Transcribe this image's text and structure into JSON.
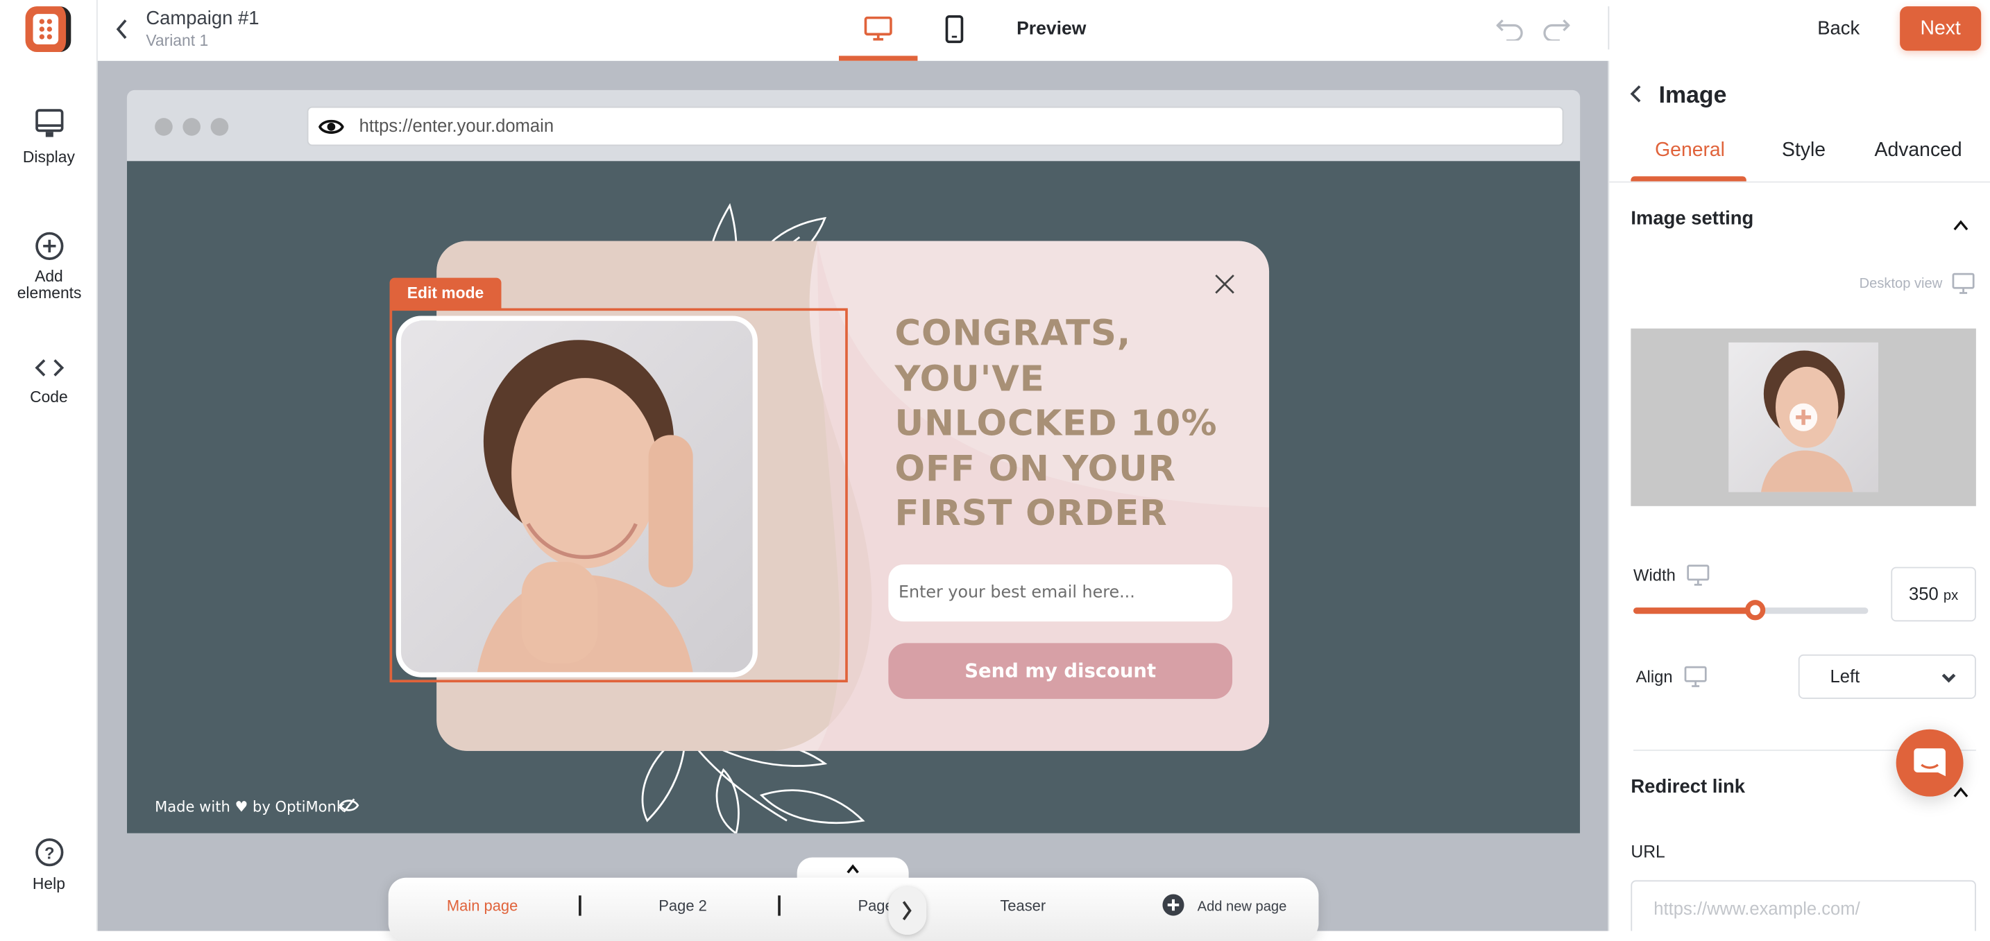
{
  "header": {
    "campaign_title": "Campaign #1",
    "variant": "Variant 1",
    "preview_label": "Preview",
    "back_label": "Back",
    "next_label": "Next"
  },
  "sidebar": {
    "items": [
      {
        "label": "Display",
        "icon": "monitor-icon"
      },
      {
        "label": "Add elements",
        "icon": "plus-circle-icon"
      },
      {
        "label": "Code",
        "icon": "code-icon"
      }
    ],
    "help_label": "Help"
  },
  "browser": {
    "url": "https://enter.your.domain"
  },
  "popup": {
    "edit_mode_label": "Edit mode",
    "headline": "CONGRATS, YOU'VE UNLOCKED 10% OFF ON YOUR FIRST ORDER",
    "email_placeholder": "Enter your best email here...",
    "cta_label": "Send my discount",
    "footer": "Made with ♥ by OptiMonk"
  },
  "pages": {
    "items": [
      "Main page",
      "Page 2",
      "Page 3",
      "Teaser"
    ],
    "active": "Main page",
    "add_label": "Add new page"
  },
  "panel": {
    "title": "Image",
    "tabs": [
      "General",
      "Style",
      "Advanced"
    ],
    "active_tab": "General",
    "section_image": "Image setting",
    "desktop_view": "Desktop view",
    "width_label": "Width",
    "width_value": "350",
    "width_unit": "px",
    "width_slider_fraction": 0.52,
    "align_label": "Align",
    "align_value": "Left",
    "section_redirect": "Redirect link",
    "url_label": "URL",
    "url_placeholder": "https://www.example.com/"
  },
  "colors": {
    "accent": "#e0633b",
    "site_bg": "#4e5f66",
    "headline": "#a89076",
    "cta": "#d7a0a6"
  }
}
